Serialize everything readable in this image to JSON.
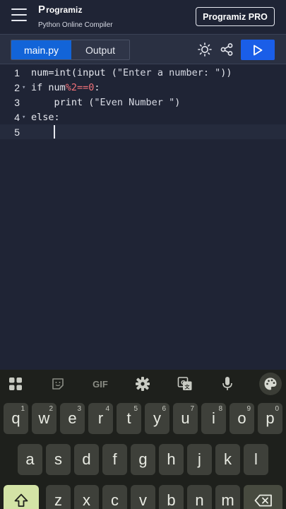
{
  "header": {
    "brand_name": "rogramiz",
    "brand_mark": "P",
    "subtitle": "Python Online Compiler",
    "pro_button": "Programiz PRO"
  },
  "toolbar": {
    "tabs": [
      {
        "label": "main.py",
        "active": true
      },
      {
        "label": "Output",
        "active": false
      }
    ]
  },
  "editor": {
    "lines": [
      {
        "num": "1",
        "fold": ""
      },
      {
        "num": "2",
        "fold": "▾"
      },
      {
        "num": "3",
        "fold": ""
      },
      {
        "num": "4",
        "fold": "▾"
      },
      {
        "num": "5",
        "fold": ""
      }
    ],
    "code": {
      "l1_a": "num=int(input (",
      "l1_b": "\"Enter a number: \"",
      "l1_c": "))",
      "l2_a": "if num",
      "l2_b": "%2==0",
      "l2_c": ":",
      "l3_a": "    print (",
      "l3_b": "\"Even Number \"",
      "l3_c": ")",
      "l4": "else:"
    }
  },
  "keyboard": {
    "toolbar": {
      "gif": "GIF"
    },
    "row1": [
      {
        "k": "q",
        "s": "1"
      },
      {
        "k": "w",
        "s": "2"
      },
      {
        "k": "e",
        "s": "3"
      },
      {
        "k": "r",
        "s": "4"
      },
      {
        "k": "t",
        "s": "5"
      },
      {
        "k": "y",
        "s": "6"
      },
      {
        "k": "u",
        "s": "7"
      },
      {
        "k": "i",
        "s": "8"
      },
      {
        "k": "o",
        "s": "9"
      },
      {
        "k": "p",
        "s": "0"
      }
    ],
    "row2": [
      "a",
      "s",
      "d",
      "f",
      "g",
      "h",
      "j",
      "k",
      "l"
    ],
    "row3": [
      "z",
      "x",
      "c",
      "v",
      "b",
      "n",
      "m"
    ]
  },
  "colors": {
    "run_button": "#1a5ee8",
    "active_tab": "#1264d8",
    "editor_bg": "#1f2435"
  }
}
